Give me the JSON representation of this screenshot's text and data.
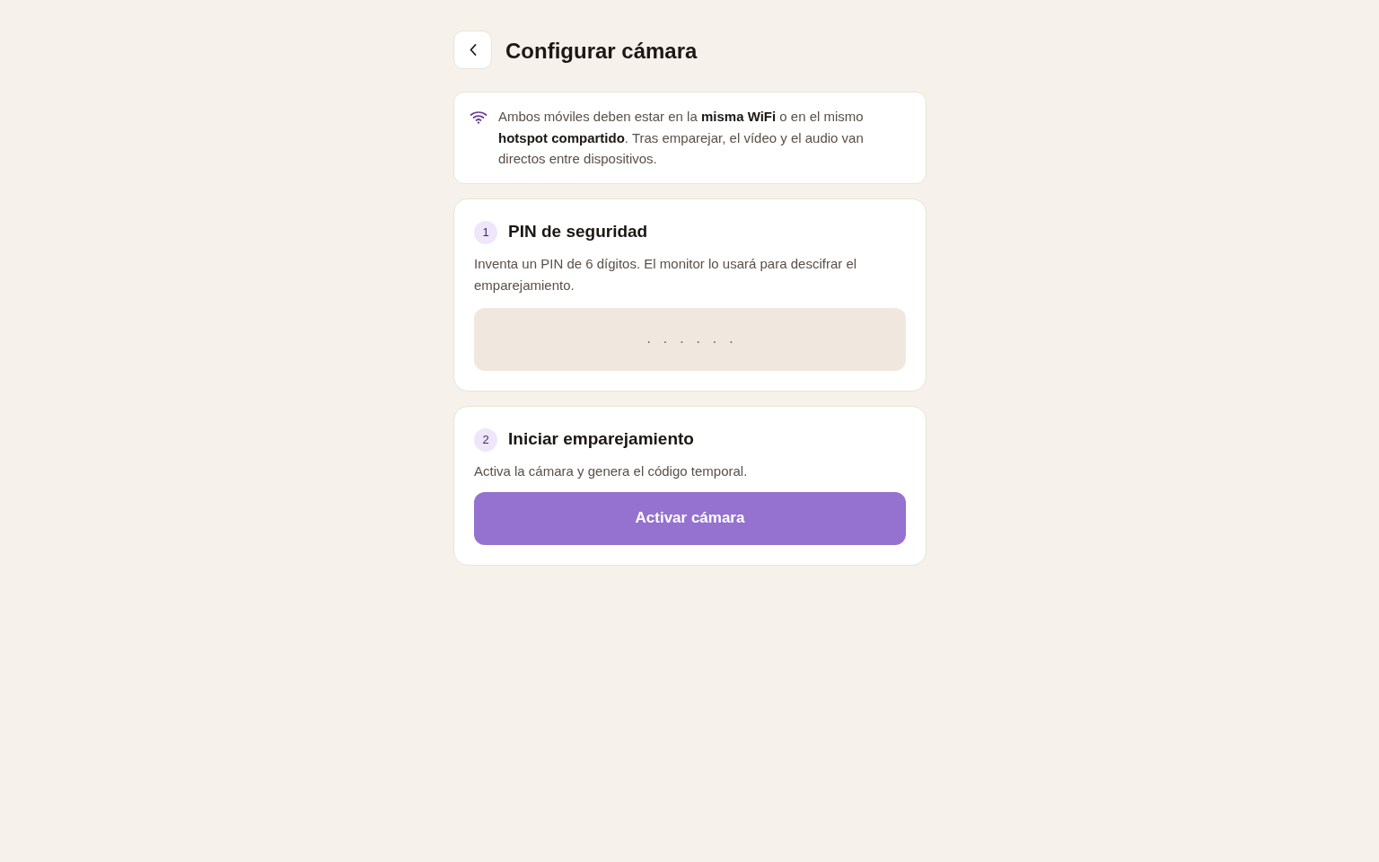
{
  "header": {
    "title": "Configurar cámara"
  },
  "notice": {
    "text": "Ambos móviles deben estar en la **misma WiFi** o en el mismo **hotspot compartido**. Tras emparejar, el vídeo y el audio van directos entre dispositivos."
  },
  "steps": [
    {
      "kind": "input",
      "number": "1",
      "title": "PIN de seguridad",
      "description": "Inventa un PIN de 6 dígitos. El monitor lo usará para descifrar el emparejamiento.",
      "placeholder": "······"
    },
    {
      "kind": "button",
      "number": "2",
      "title": "Iniciar emparejamiento",
      "description": "Activa la cámara y genera el código temporal.",
      "button_label": "Activar cámara"
    }
  ]
}
